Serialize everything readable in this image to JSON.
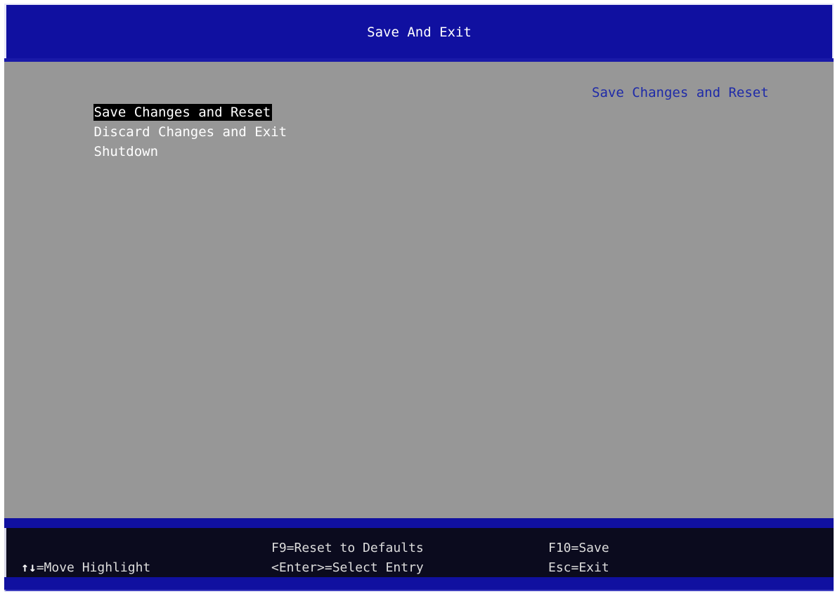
{
  "header": {
    "title": "Save And Exit"
  },
  "menu": {
    "items": [
      {
        "label": "Save Changes and Reset",
        "selected": true
      },
      {
        "label": "Discard Changes and Exit",
        "selected": false
      },
      {
        "label": "Shutdown",
        "selected": false
      }
    ]
  },
  "help": {
    "text": "Save Changes and Reset"
  },
  "footer": {
    "move_arrows": "↑↓",
    "move_label": "=Move Highlight",
    "reset_defaults": "F9=Reset to Defaults",
    "select_entry": "<Enter>=Select Entry",
    "save": "F10=Save",
    "exit": "Esc=Exit"
  },
  "colors": {
    "header_bg": "#1010a0",
    "main_bg": "#979797",
    "footer_bg": "#0b0b1e",
    "help_text": "#1e2aa8",
    "selected_bg": "#000000"
  }
}
